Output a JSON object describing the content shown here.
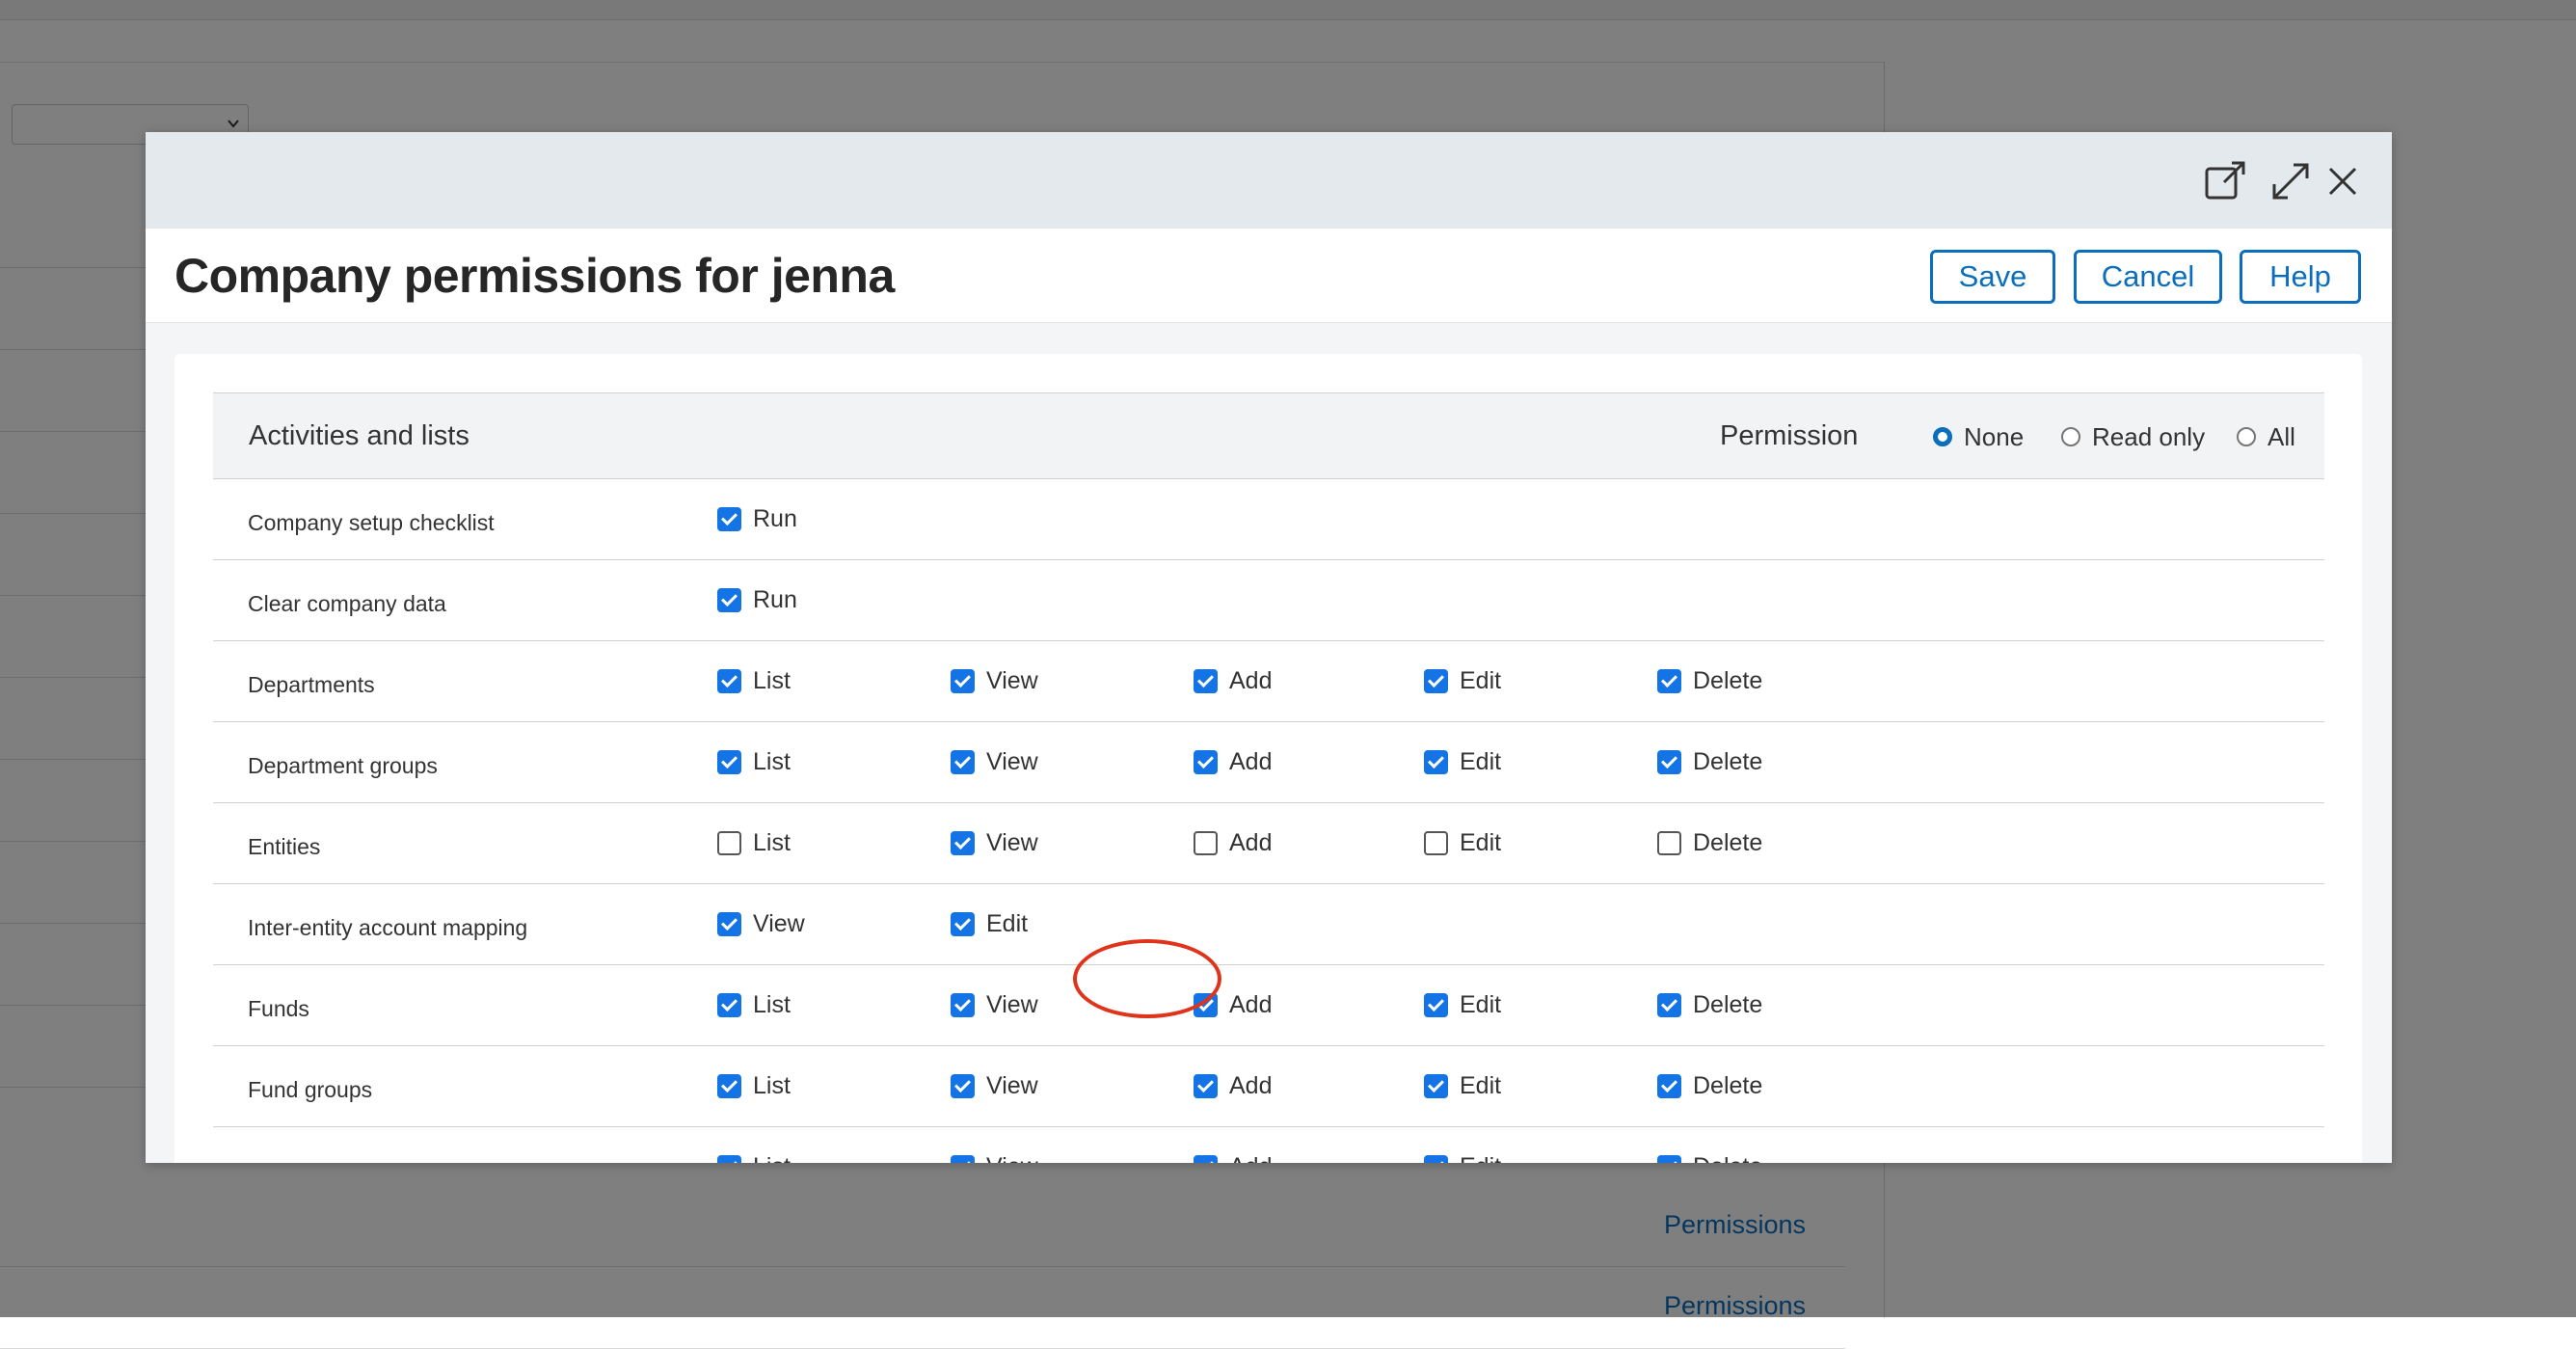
{
  "background": {
    "links": [
      "Permissions",
      "Permissions"
    ]
  },
  "modal": {
    "title": "Company permissions for jenna",
    "header_icons": [
      "open-in-new-window-icon",
      "expand-icon",
      "close-icon"
    ],
    "buttons": {
      "save": "Save",
      "cancel": "Cancel",
      "help": "Help"
    },
    "section": {
      "title": "Activities and lists",
      "permission_label": "Permission",
      "radio_options": [
        {
          "label": "None",
          "selected": true
        },
        {
          "label": "Read only",
          "selected": false
        },
        {
          "label": "All",
          "selected": false
        }
      ]
    },
    "rows": [
      {
        "label": "Company setup checklist",
        "cells": [
          {
            "label": "Run",
            "checked": true
          }
        ]
      },
      {
        "label": "Clear company data",
        "cells": [
          {
            "label": "Run",
            "checked": true
          }
        ]
      },
      {
        "label": "Departments",
        "cells": [
          {
            "label": "List",
            "checked": true
          },
          {
            "label": "View",
            "checked": true
          },
          {
            "label": "Add",
            "checked": true
          },
          {
            "label": "Edit",
            "checked": true
          },
          {
            "label": "Delete",
            "checked": true
          }
        ]
      },
      {
        "label": "Department groups",
        "cells": [
          {
            "label": "List",
            "checked": true
          },
          {
            "label": "View",
            "checked": true
          },
          {
            "label": "Add",
            "checked": true
          },
          {
            "label": "Edit",
            "checked": true
          },
          {
            "label": "Delete",
            "checked": true
          }
        ]
      },
      {
        "label": "Entities",
        "cells": [
          {
            "label": "List",
            "checked": false
          },
          {
            "label": "View",
            "checked": true
          },
          {
            "label": "Add",
            "checked": false
          },
          {
            "label": "Edit",
            "checked": false
          },
          {
            "label": "Delete",
            "checked": false
          }
        ]
      },
      {
        "label": "Inter-entity account mapping",
        "cells": [
          {
            "label": "View",
            "checked": true
          },
          {
            "label": "Edit",
            "checked": true
          }
        ]
      },
      {
        "label": "Funds",
        "cells": [
          {
            "label": "List",
            "checked": true
          },
          {
            "label": "View",
            "checked": true
          },
          {
            "label": "Add",
            "checked": true
          },
          {
            "label": "Edit",
            "checked": true
          },
          {
            "label": "Delete",
            "checked": true
          }
        ]
      },
      {
        "label": "Fund groups",
        "cells": [
          {
            "label": "List",
            "checked": true
          },
          {
            "label": "View",
            "checked": true
          },
          {
            "label": "Add",
            "checked": true
          },
          {
            "label": "Edit",
            "checked": true
          },
          {
            "label": "Delete",
            "checked": true
          }
        ]
      },
      {
        "label": "",
        "cells": [
          {
            "label": "List",
            "checked": true
          },
          {
            "label": "View",
            "checked": true
          },
          {
            "label": "Add",
            "checked": true
          },
          {
            "label": "Edit",
            "checked": true
          },
          {
            "label": "Delete",
            "checked": true
          }
        ]
      }
    ]
  },
  "colors": {
    "accent": "#0a6ebd",
    "checkbox_checked": "#1474e6",
    "highlight": "#e0331b",
    "modal_header": "#e3e9ec"
  }
}
